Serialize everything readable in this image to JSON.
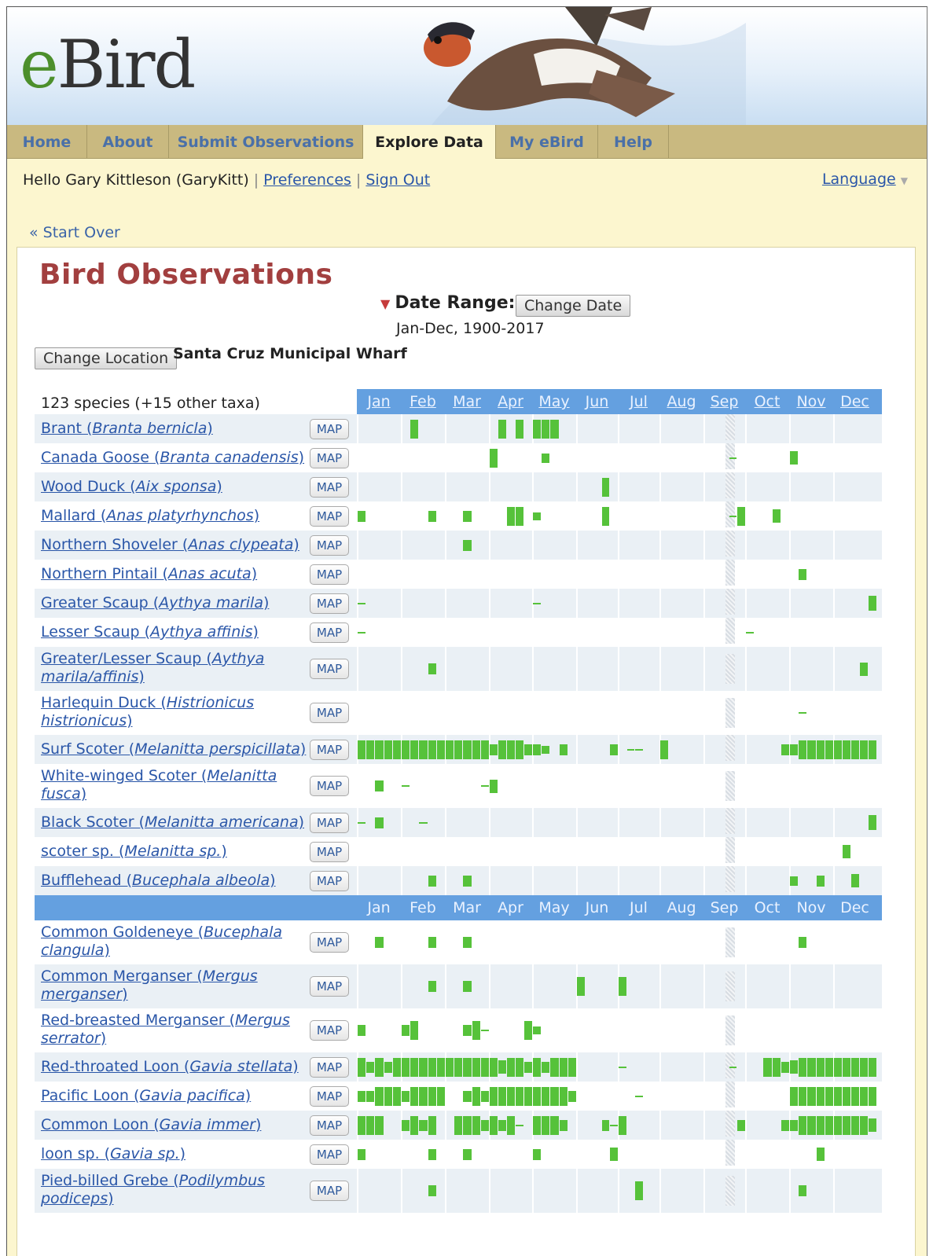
{
  "site": {
    "logo_e": "e",
    "logo_rest": "Bird"
  },
  "nav": [
    {
      "label": "Home",
      "active": false
    },
    {
      "label": "About",
      "active": false
    },
    {
      "label": "Submit Observations",
      "active": false
    },
    {
      "label": "Explore Data",
      "active": true
    },
    {
      "label": "My eBird",
      "active": false
    },
    {
      "label": "Help",
      "active": false
    }
  ],
  "user": {
    "greeting": "Hello Gary Kittleson (GaryKitt)",
    "preferences": "Preferences",
    "signout": "Sign Out",
    "language": "Language"
  },
  "start_over": "« Start Over",
  "page_title": "Bird Observations",
  "date_range": {
    "label": "Date Range:",
    "button": "Change Date",
    "value": "Jan-Dec, 1900-2017"
  },
  "location": {
    "button": "Change Location",
    "name": "Santa Cruz Municipal Wharf"
  },
  "species_count": "123 species (+15 other taxa)",
  "months": [
    "Jan",
    "Feb",
    "Mar",
    "Apr",
    "May",
    "Jun",
    "Jul",
    "Aug",
    "Sep",
    "Oct",
    "Nov",
    "Dec"
  ],
  "map_label": "MAP",
  "species": [
    {
      "line1": "Brant (",
      "sci1": "Branta bernicla",
      "line2": "",
      "sci2": "",
      "end": ")",
      "bars": [
        [
          1,
          2,
          1
        ],
        [
          3,
          2,
          1
        ],
        [
          3,
          4,
          1
        ],
        [
          4,
          1,
          1
        ],
        [
          4,
          2,
          1
        ],
        [
          4,
          3,
          1
        ]
      ]
    },
    {
      "line1": "Canada Goose (",
      "sci1": "Branta canadensis",
      "line2": "",
      "sci2": "",
      "end": ")",
      "bars": [
        [
          3,
          1,
          1
        ],
        [
          4,
          2,
          0.5
        ],
        [
          8,
          4,
          0.1
        ],
        [
          10,
          1,
          0.7
        ]
      ]
    },
    {
      "line1": "Wood Duck (",
      "sci1": "Aix sponsa",
      "line2": "",
      "sci2": "",
      "end": ")",
      "bars": [
        [
          5,
          4,
          1
        ]
      ]
    },
    {
      "line1": "Mallard (",
      "sci1": "Anas platyrhynchos",
      "line2": "",
      "sci2": "",
      "end": ")",
      "bars": [
        [
          0,
          1,
          0.6
        ],
        [
          1,
          4,
          0.6
        ],
        [
          2,
          3,
          0.6
        ],
        [
          3,
          3,
          1
        ],
        [
          3,
          4,
          1
        ],
        [
          4,
          1,
          0.4
        ],
        [
          5,
          4,
          1
        ],
        [
          8,
          4,
          0.1
        ],
        [
          8,
          5,
          1
        ],
        [
          9,
          4,
          0.7
        ]
      ]
    },
    {
      "line1": "Northern Shoveler (",
      "sci1": "Anas clypeata",
      "line2": "",
      "sci2": "",
      "end": ")",
      "bars": [
        [
          2,
          3,
          0.6
        ]
      ]
    },
    {
      "line1": "Northern Pintail (",
      "sci1": "Anas acuta",
      "line2": "",
      "sci2": "",
      "end": ")",
      "bars": [
        [
          10,
          2,
          0.6
        ]
      ]
    },
    {
      "line1": "Greater Scaup (",
      "sci1": "Aythya marila",
      "line2": "",
      "sci2": "",
      "end": ")",
      "bars": [
        [
          0,
          1,
          0.1
        ],
        [
          4,
          1,
          0.1
        ],
        [
          11,
          5,
          0.8
        ]
      ]
    },
    {
      "line1": "Lesser Scaup (",
      "sci1": "Aythya affinis",
      "line2": "",
      "sci2": "",
      "end": ")",
      "bars": [
        [
          0,
          1,
          0.1
        ],
        [
          9,
          1,
          0.1
        ]
      ]
    },
    {
      "line1": "Greater/Lesser Scaup (",
      "sci1": "Aythya",
      "line2": "",
      "sci2": "marila/affinis",
      "end": ")",
      "bars": [
        [
          1,
          4,
          0.6
        ],
        [
          11,
          4,
          0.7
        ]
      ]
    },
    {
      "line1": "Harlequin Duck (",
      "sci1": "Histrionicus",
      "line2": "",
      "sci2": "histrionicus",
      "end": ")",
      "bars": [
        [
          10,
          2,
          0.1
        ]
      ]
    },
    {
      "line1": "Surf Scoter (",
      "sci1": "Melanitta perspicillata",
      "line2": "",
      "sci2": "",
      "end": ")",
      "bars": [
        [
          0,
          1,
          1
        ],
        [
          0,
          2,
          1
        ],
        [
          0,
          3,
          1
        ],
        [
          0,
          4,
          1
        ],
        [
          0,
          5,
          1
        ],
        [
          1,
          1,
          1
        ],
        [
          1,
          2,
          1
        ],
        [
          1,
          3,
          1
        ],
        [
          1,
          4,
          1
        ],
        [
          1,
          5,
          1
        ],
        [
          2,
          1,
          1
        ],
        [
          2,
          2,
          1
        ],
        [
          2,
          3,
          1
        ],
        [
          2,
          4,
          1
        ],
        [
          2,
          5,
          1
        ],
        [
          3,
          1,
          0.6
        ],
        [
          3,
          2,
          1
        ],
        [
          3,
          3,
          1
        ],
        [
          3,
          4,
          1
        ],
        [
          3,
          5,
          0.6
        ],
        [
          4,
          1,
          0.6
        ],
        [
          4,
          2,
          0.4
        ],
        [
          4,
          4,
          0.6
        ],
        [
          5,
          5,
          0.6
        ],
        [
          6,
          2,
          0.1
        ],
        [
          6,
          3,
          0.1
        ],
        [
          7,
          1,
          1
        ],
        [
          9,
          5,
          0.6
        ],
        [
          10,
          1,
          0.6
        ],
        [
          10,
          2,
          1
        ],
        [
          10,
          3,
          1
        ],
        [
          10,
          4,
          1
        ],
        [
          10,
          5,
          1
        ],
        [
          11,
          1,
          1
        ],
        [
          11,
          2,
          1
        ],
        [
          11,
          3,
          1
        ],
        [
          11,
          4,
          1
        ],
        [
          11,
          5,
          1
        ]
      ]
    },
    {
      "line1": "White-winged Scoter (",
      "sci1": "Melanitta",
      "line2": "",
      "sci2": "fusca",
      "end": ")",
      "bars": [
        [
          0,
          3,
          0.6
        ],
        [
          1,
          1,
          0.1
        ],
        [
          2,
          5,
          0.1
        ],
        [
          3,
          1,
          0.7
        ]
      ]
    },
    {
      "line1": "Black Scoter (",
      "sci1": "Melanitta americana",
      "line2": "",
      "sci2": "",
      "end": ")",
      "bars": [
        [
          0,
          1,
          0.1
        ],
        [
          0,
          3,
          0.6
        ],
        [
          1,
          3,
          0.1
        ],
        [
          11,
          5,
          0.8
        ]
      ]
    },
    {
      "line1": "scoter sp. (",
      "sci1": "Melanitta sp.",
      "line2": "",
      "sci2": "",
      "end": ")",
      "bars": [
        [
          11,
          2,
          0.7
        ]
      ]
    },
    {
      "line1": "Bufflehead (",
      "sci1": "Bucephala albeola",
      "line2": "",
      "sci2": "",
      "end": ")",
      "bars": [
        [
          1,
          4,
          0.6
        ],
        [
          2,
          3,
          0.6
        ],
        [
          10,
          1,
          0.5
        ],
        [
          10,
          4,
          0.6
        ],
        [
          11,
          3,
          0.7
        ]
      ]
    },
    {
      "line1": "Common Goldeneye (",
      "sci1": "Bucephala",
      "line2": "",
      "sci2": "clangula",
      "end": ")",
      "bars": [
        [
          0,
          3,
          0.6
        ],
        [
          1,
          4,
          0.6
        ],
        [
          2,
          3,
          0.6
        ],
        [
          10,
          2,
          0.6
        ]
      ]
    },
    {
      "line1": "Common Merganser (",
      "sci1": "Mergus",
      "line2": "",
      "sci2": "merganser",
      "end": ")",
      "bars": [
        [
          1,
          4,
          0.6
        ],
        [
          2,
          3,
          0.6
        ],
        [
          5,
          1,
          1
        ],
        [
          6,
          1,
          1
        ]
      ]
    },
    {
      "line1": "Red-breasted Merganser (",
      "sci1": "Mergus",
      "line2": "",
      "sci2": "serrator",
      "end": ")",
      "bars": [
        [
          0,
          1,
          0.6
        ],
        [
          1,
          1,
          0.6
        ],
        [
          1,
          2,
          1
        ],
        [
          2,
          3,
          0.6
        ],
        [
          2,
          4,
          1
        ],
        [
          2,
          5,
          0.1
        ],
        [
          3,
          5,
          1
        ],
        [
          4,
          1,
          0.4
        ]
      ]
    },
    {
      "line1": "Red-throated Loon (",
      "sci1": "Gavia stellata",
      "line2": "",
      "sci2": "",
      "end": ")",
      "bars": [
        [
          0,
          1,
          1
        ],
        [
          0,
          2,
          0.6
        ],
        [
          0,
          3,
          1
        ],
        [
          0,
          4,
          0.6
        ],
        [
          0,
          5,
          1
        ],
        [
          1,
          1,
          1
        ],
        [
          1,
          2,
          1
        ],
        [
          1,
          3,
          1
        ],
        [
          1,
          4,
          1
        ],
        [
          1,
          5,
          1
        ],
        [
          2,
          1,
          1
        ],
        [
          2,
          2,
          1
        ],
        [
          2,
          3,
          1
        ],
        [
          2,
          4,
          1
        ],
        [
          2,
          5,
          1
        ],
        [
          3,
          1,
          1
        ],
        [
          3,
          2,
          0.7
        ],
        [
          3,
          3,
          1
        ],
        [
          3,
          4,
          1
        ],
        [
          3,
          5,
          0.6
        ],
        [
          4,
          1,
          1
        ],
        [
          4,
          2,
          0.6
        ],
        [
          4,
          3,
          1
        ],
        [
          4,
          4,
          1
        ],
        [
          4,
          5,
          1
        ],
        [
          6,
          1,
          0.1
        ],
        [
          8,
          4,
          0.1
        ],
        [
          9,
          3,
          1
        ],
        [
          9,
          4,
          1
        ],
        [
          9,
          5,
          0.6
        ],
        [
          10,
          1,
          0.7
        ],
        [
          10,
          2,
          1
        ],
        [
          10,
          3,
          1
        ],
        [
          10,
          4,
          1
        ],
        [
          10,
          5,
          1
        ],
        [
          11,
          1,
          1
        ],
        [
          11,
          2,
          1
        ],
        [
          11,
          3,
          1
        ],
        [
          11,
          4,
          1
        ],
        [
          11,
          5,
          1
        ]
      ]
    },
    {
      "line1": "Pacific Loon (",
      "sci1": "Gavia pacifica",
      "line2": "",
      "sci2": "",
      "end": ")",
      "bars": [
        [
          0,
          1,
          0.6
        ],
        [
          0,
          2,
          0.6
        ],
        [
          0,
          3,
          1
        ],
        [
          0,
          4,
          1
        ],
        [
          0,
          5,
          1
        ],
        [
          1,
          1,
          0.6
        ],
        [
          1,
          2,
          1
        ],
        [
          1,
          3,
          1
        ],
        [
          1,
          4,
          1
        ],
        [
          1,
          5,
          1
        ],
        [
          2,
          3,
          0.6
        ],
        [
          2,
          4,
          1
        ],
        [
          2,
          5,
          0.6
        ],
        [
          3,
          1,
          1
        ],
        [
          3,
          2,
          1
        ],
        [
          3,
          3,
          1
        ],
        [
          3,
          4,
          1
        ],
        [
          3,
          5,
          1
        ],
        [
          4,
          1,
          1
        ],
        [
          4,
          2,
          1
        ],
        [
          4,
          3,
          1
        ],
        [
          4,
          4,
          1
        ],
        [
          4,
          5,
          0.6
        ],
        [
          6,
          3,
          0.1
        ],
        [
          10,
          1,
          1
        ],
        [
          10,
          2,
          1
        ],
        [
          10,
          3,
          1
        ],
        [
          10,
          4,
          1
        ],
        [
          10,
          5,
          1
        ],
        [
          11,
          1,
          1
        ],
        [
          11,
          2,
          1
        ],
        [
          11,
          3,
          1
        ],
        [
          11,
          4,
          1
        ],
        [
          11,
          5,
          1
        ]
      ]
    },
    {
      "line1": "Common Loon (",
      "sci1": "Gavia immer",
      "line2": "",
      "sci2": "",
      "end": ")",
      "bars": [
        [
          0,
          1,
          1
        ],
        [
          0,
          2,
          1
        ],
        [
          0,
          3,
          1
        ],
        [
          1,
          1,
          0.6
        ],
        [
          1,
          2,
          1
        ],
        [
          1,
          3,
          0.6
        ],
        [
          1,
          4,
          1
        ],
        [
          2,
          2,
          1
        ],
        [
          2,
          3,
          1
        ],
        [
          2,
          4,
          1
        ],
        [
          2,
          5,
          0.6
        ],
        [
          3,
          1,
          1
        ],
        [
          3,
          2,
          0.6
        ],
        [
          3,
          3,
          1
        ],
        [
          3,
          4,
          0.1
        ],
        [
          4,
          1,
          1
        ],
        [
          4,
          2,
          1
        ],
        [
          4,
          3,
          1
        ],
        [
          4,
          4,
          0.6
        ],
        [
          5,
          4,
          0.6
        ],
        [
          5,
          5,
          0.1
        ],
        [
          6,
          1,
          1
        ],
        [
          8,
          5,
          0.6
        ],
        [
          9,
          5,
          0.6
        ],
        [
          10,
          1,
          0.6
        ],
        [
          10,
          2,
          1
        ],
        [
          10,
          3,
          1
        ],
        [
          10,
          4,
          1
        ],
        [
          10,
          5,
          1
        ],
        [
          11,
          1,
          1
        ],
        [
          11,
          2,
          1
        ],
        [
          11,
          3,
          1
        ],
        [
          11,
          4,
          1
        ],
        [
          11,
          5,
          0.7
        ]
      ]
    },
    {
      "line1": "loon sp. (",
      "sci1": "Gavia sp.",
      "line2": "",
      "sci2": "",
      "end": ")",
      "bars": [
        [
          0,
          1,
          0.6
        ],
        [
          1,
          4,
          0.6
        ],
        [
          2,
          3,
          0.6
        ],
        [
          4,
          1,
          0.6
        ],
        [
          5,
          5,
          0.7
        ],
        [
          10,
          4,
          0.7
        ]
      ]
    },
    {
      "line1": "Pied-billed Grebe (",
      "sci1": "Podilymbus",
      "line2": "",
      "sci2": "podiceps",
      "end": ")",
      "bars": [
        [
          1,
          4,
          0.6
        ],
        [
          6,
          3,
          1
        ],
        [
          10,
          2,
          0.6
        ]
      ]
    }
  ],
  "colors": {
    "accent_title": "#a23f3f",
    "bar_green": "#56c23a",
    "month_header": "#64a0e0",
    "link": "#2a56a8"
  }
}
